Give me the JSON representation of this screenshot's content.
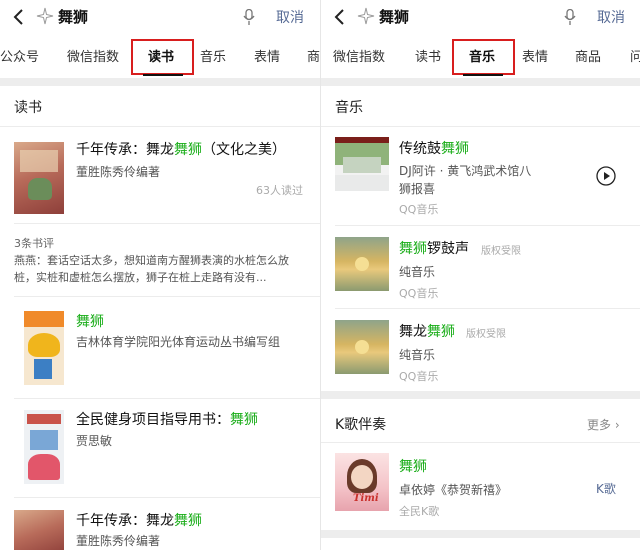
{
  "search": {
    "query": "舞狮",
    "cancel": "取消"
  },
  "left": {
    "tabs": [
      "公众号",
      "微信指数",
      "读书",
      "音乐",
      "表情",
      "商"
    ],
    "section_title": "读书",
    "book1": {
      "title_pre": "千年传承：舞龙",
      "title_hl": "舞狮",
      "title_post": "（文化之美）",
      "author": "董胜陈秀伶编著",
      "readers": "63人读过"
    },
    "review": {
      "count": "3条书评",
      "text": "燕燕：套话空话太多，想知道南方醒狮表演的水桩怎么放桩，实桩和虚桩怎么摆放，狮子在桩上走路有没有..."
    },
    "book2": {
      "title_hl": "舞狮",
      "author": "吉林体育学院阳光体育运动丛书编写组"
    },
    "book3": {
      "title_pre": "全民健身项目指导用书：",
      "title_hl": "舞狮",
      "author": "贾思敏"
    },
    "book4": {
      "title_pre": "千年传承：舞龙",
      "title_hl": "舞狮",
      "author": "董胜陈秀伶编著"
    }
  },
  "right": {
    "tabs": [
      "微信指数",
      "读书",
      "音乐",
      "表情",
      "商品",
      "问"
    ],
    "section_title": "音乐",
    "song1": {
      "title_pre": "传统鼓",
      "title_hl": "舞狮",
      "artist_line1": "DJ阿许 · 黄飞鸿武术馆八",
      "artist_line2": "狮报喜",
      "source": "QQ音乐"
    },
    "song2": {
      "title_hl": "舞狮",
      "title_post": "锣鼓声",
      "tag": "版权受限",
      "artist": "纯音乐",
      "source": "QQ音乐"
    },
    "song3": {
      "title_pre": "舞龙",
      "title_hl": "舞狮",
      "tag": "版权受限",
      "artist": "纯音乐",
      "source": "QQ音乐"
    },
    "karaoke": {
      "section_title": "K歌伴奏",
      "more": "更多",
      "title_hl": "舞狮",
      "artist": "卓依婷《恭贺新禧》",
      "source": "全民K歌",
      "action": "K歌",
      "cover_text": "Timi"
    }
  },
  "colors": {
    "highlight": "#1aad19",
    "link": "#576b95",
    "annotation": "#d81e1e"
  }
}
